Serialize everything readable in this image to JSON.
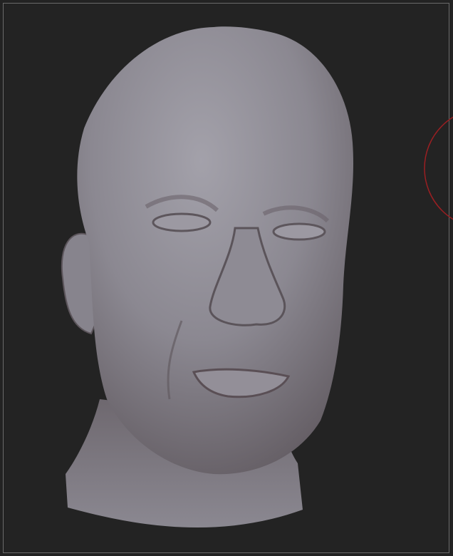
{
  "viewport": {
    "background": "#232323",
    "border_color": "#6a6a6a"
  },
  "model": {
    "icon": "sculpted-head-model",
    "base_color": "#8a8790",
    "shadow_color": "#5a4f55",
    "highlight_color": "#a6a4ad"
  },
  "brush_cursor": {
    "icon": "brush-circle-icon",
    "color": "#9a1f22"
  }
}
